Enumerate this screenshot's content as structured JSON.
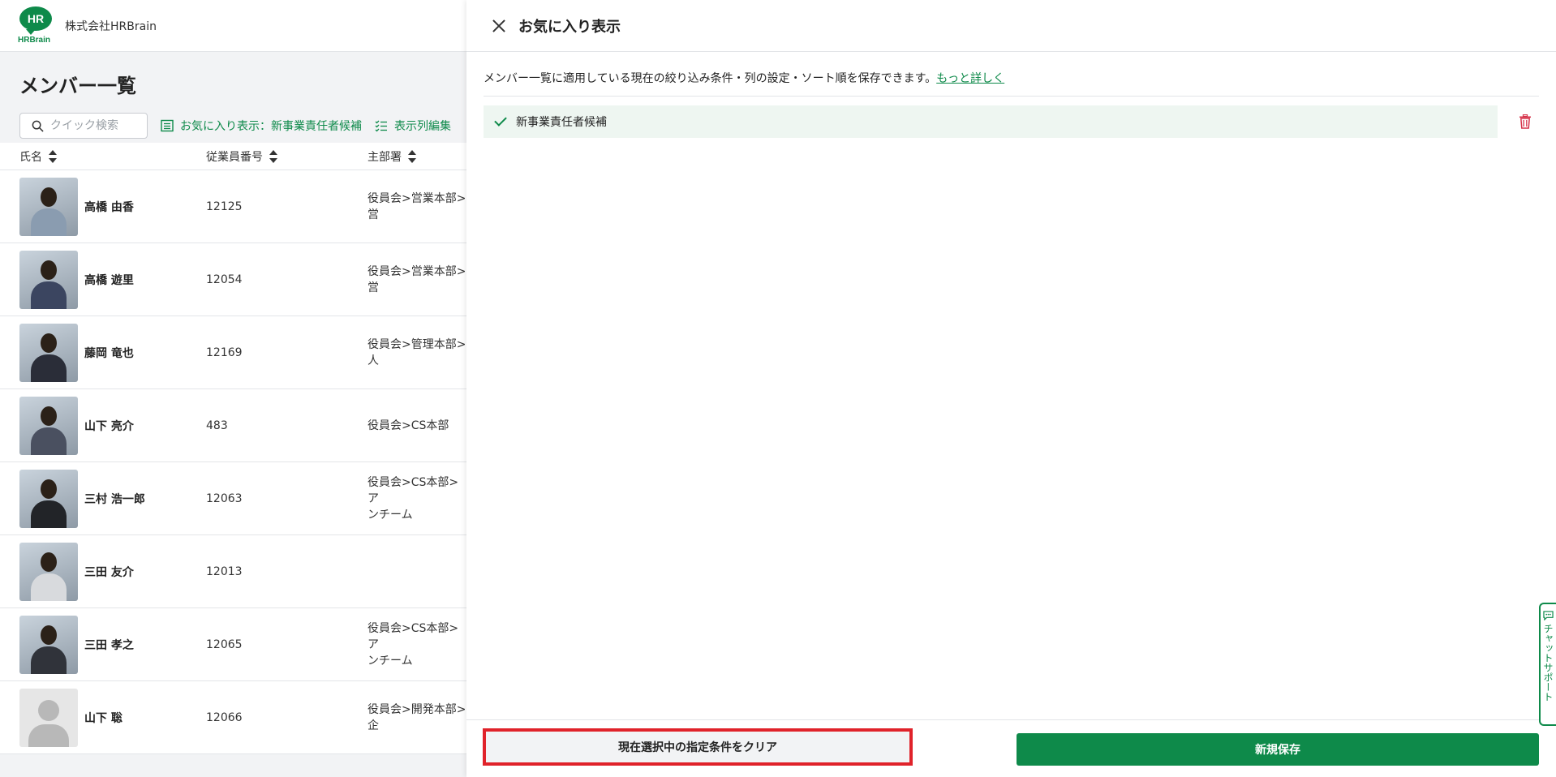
{
  "header": {
    "logo_text": "HR",
    "logo_sub": "HRBrain",
    "company": "株式会社HRBrain"
  },
  "page": {
    "title": "メンバー一覧"
  },
  "toolbar": {
    "search_placeholder": "クイック検索",
    "favorite_label": "お気に入り表示：新事業責任者候補",
    "columns_label": "表示列編集"
  },
  "table": {
    "columns": [
      "氏名",
      "従業員番号",
      "主部署"
    ],
    "rows": [
      {
        "name": "高橋 由香",
        "id": "12125",
        "dept": "役員会>営業本部>営",
        "color": "#8a9cb0"
      },
      {
        "name": "高橋 遊里",
        "id": "12054",
        "dept": "役員会>営業本部>営",
        "color": "#3b4560"
      },
      {
        "name": "藤岡 竜也",
        "id": "12169",
        "dept": "役員会>管理本部>人",
        "color": "#2a2d38"
      },
      {
        "name": "山下 亮介",
        "id": "483",
        "dept": "役員会>CS本部",
        "color": "#4a5060"
      },
      {
        "name": "三村 浩一郎",
        "id": "12063",
        "dept": "役員会>CS本部>ア\nンチーム",
        "color": "#222428"
      },
      {
        "name": "三田 友介",
        "id": "12013",
        "dept": "",
        "color": "#d8dadd"
      },
      {
        "name": "三田 孝之",
        "id": "12065",
        "dept": "役員会>CS本部>ア\nンチーム",
        "color": "#30333a"
      },
      {
        "name": "山下 聡",
        "id": "12066",
        "dept": "役員会>開発本部>企",
        "color": "placeholder"
      }
    ]
  },
  "drawer": {
    "title": "お気に入り表示",
    "description": "メンバー一覧に適用している現在の絞り込み条件・列の設定・ソート順を保存できます。",
    "more_link": "もっと詳しく",
    "favorite_item": "新事業責任者候補",
    "clear_button": "現在選択中の指定条件をクリア",
    "save_button": "新規保存"
  },
  "chat": {
    "label": "チャットサポート"
  },
  "colors": {
    "brand": "#0e8a4a",
    "highlight": "#e0222a",
    "selected_row": "#eef6f1"
  }
}
